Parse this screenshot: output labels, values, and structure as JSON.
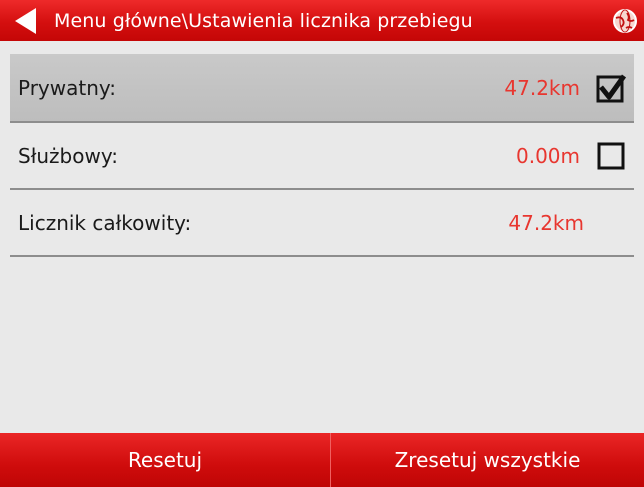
{
  "header": {
    "title": "Menu główne\\Ustawienia licznika przebiegu",
    "back_icon": "back-arrow-icon",
    "globe_icon": "globe-icon"
  },
  "rows": [
    {
      "label": "Prywatny:",
      "value": "47.2km",
      "checked": true
    },
    {
      "label": "Służbowy:",
      "value": "0.00m",
      "checked": false
    },
    {
      "label": "Licznik całkowity:",
      "value": "47.2km"
    }
  ],
  "buttons": {
    "reset": "Resetuj",
    "reset_all": "Zresetuj wszystkie"
  },
  "colors": {
    "accent": "#d40f0f",
    "value_text": "#e8362f",
    "selected_row": "#c4c4c4",
    "background": "#e9e9e9"
  }
}
